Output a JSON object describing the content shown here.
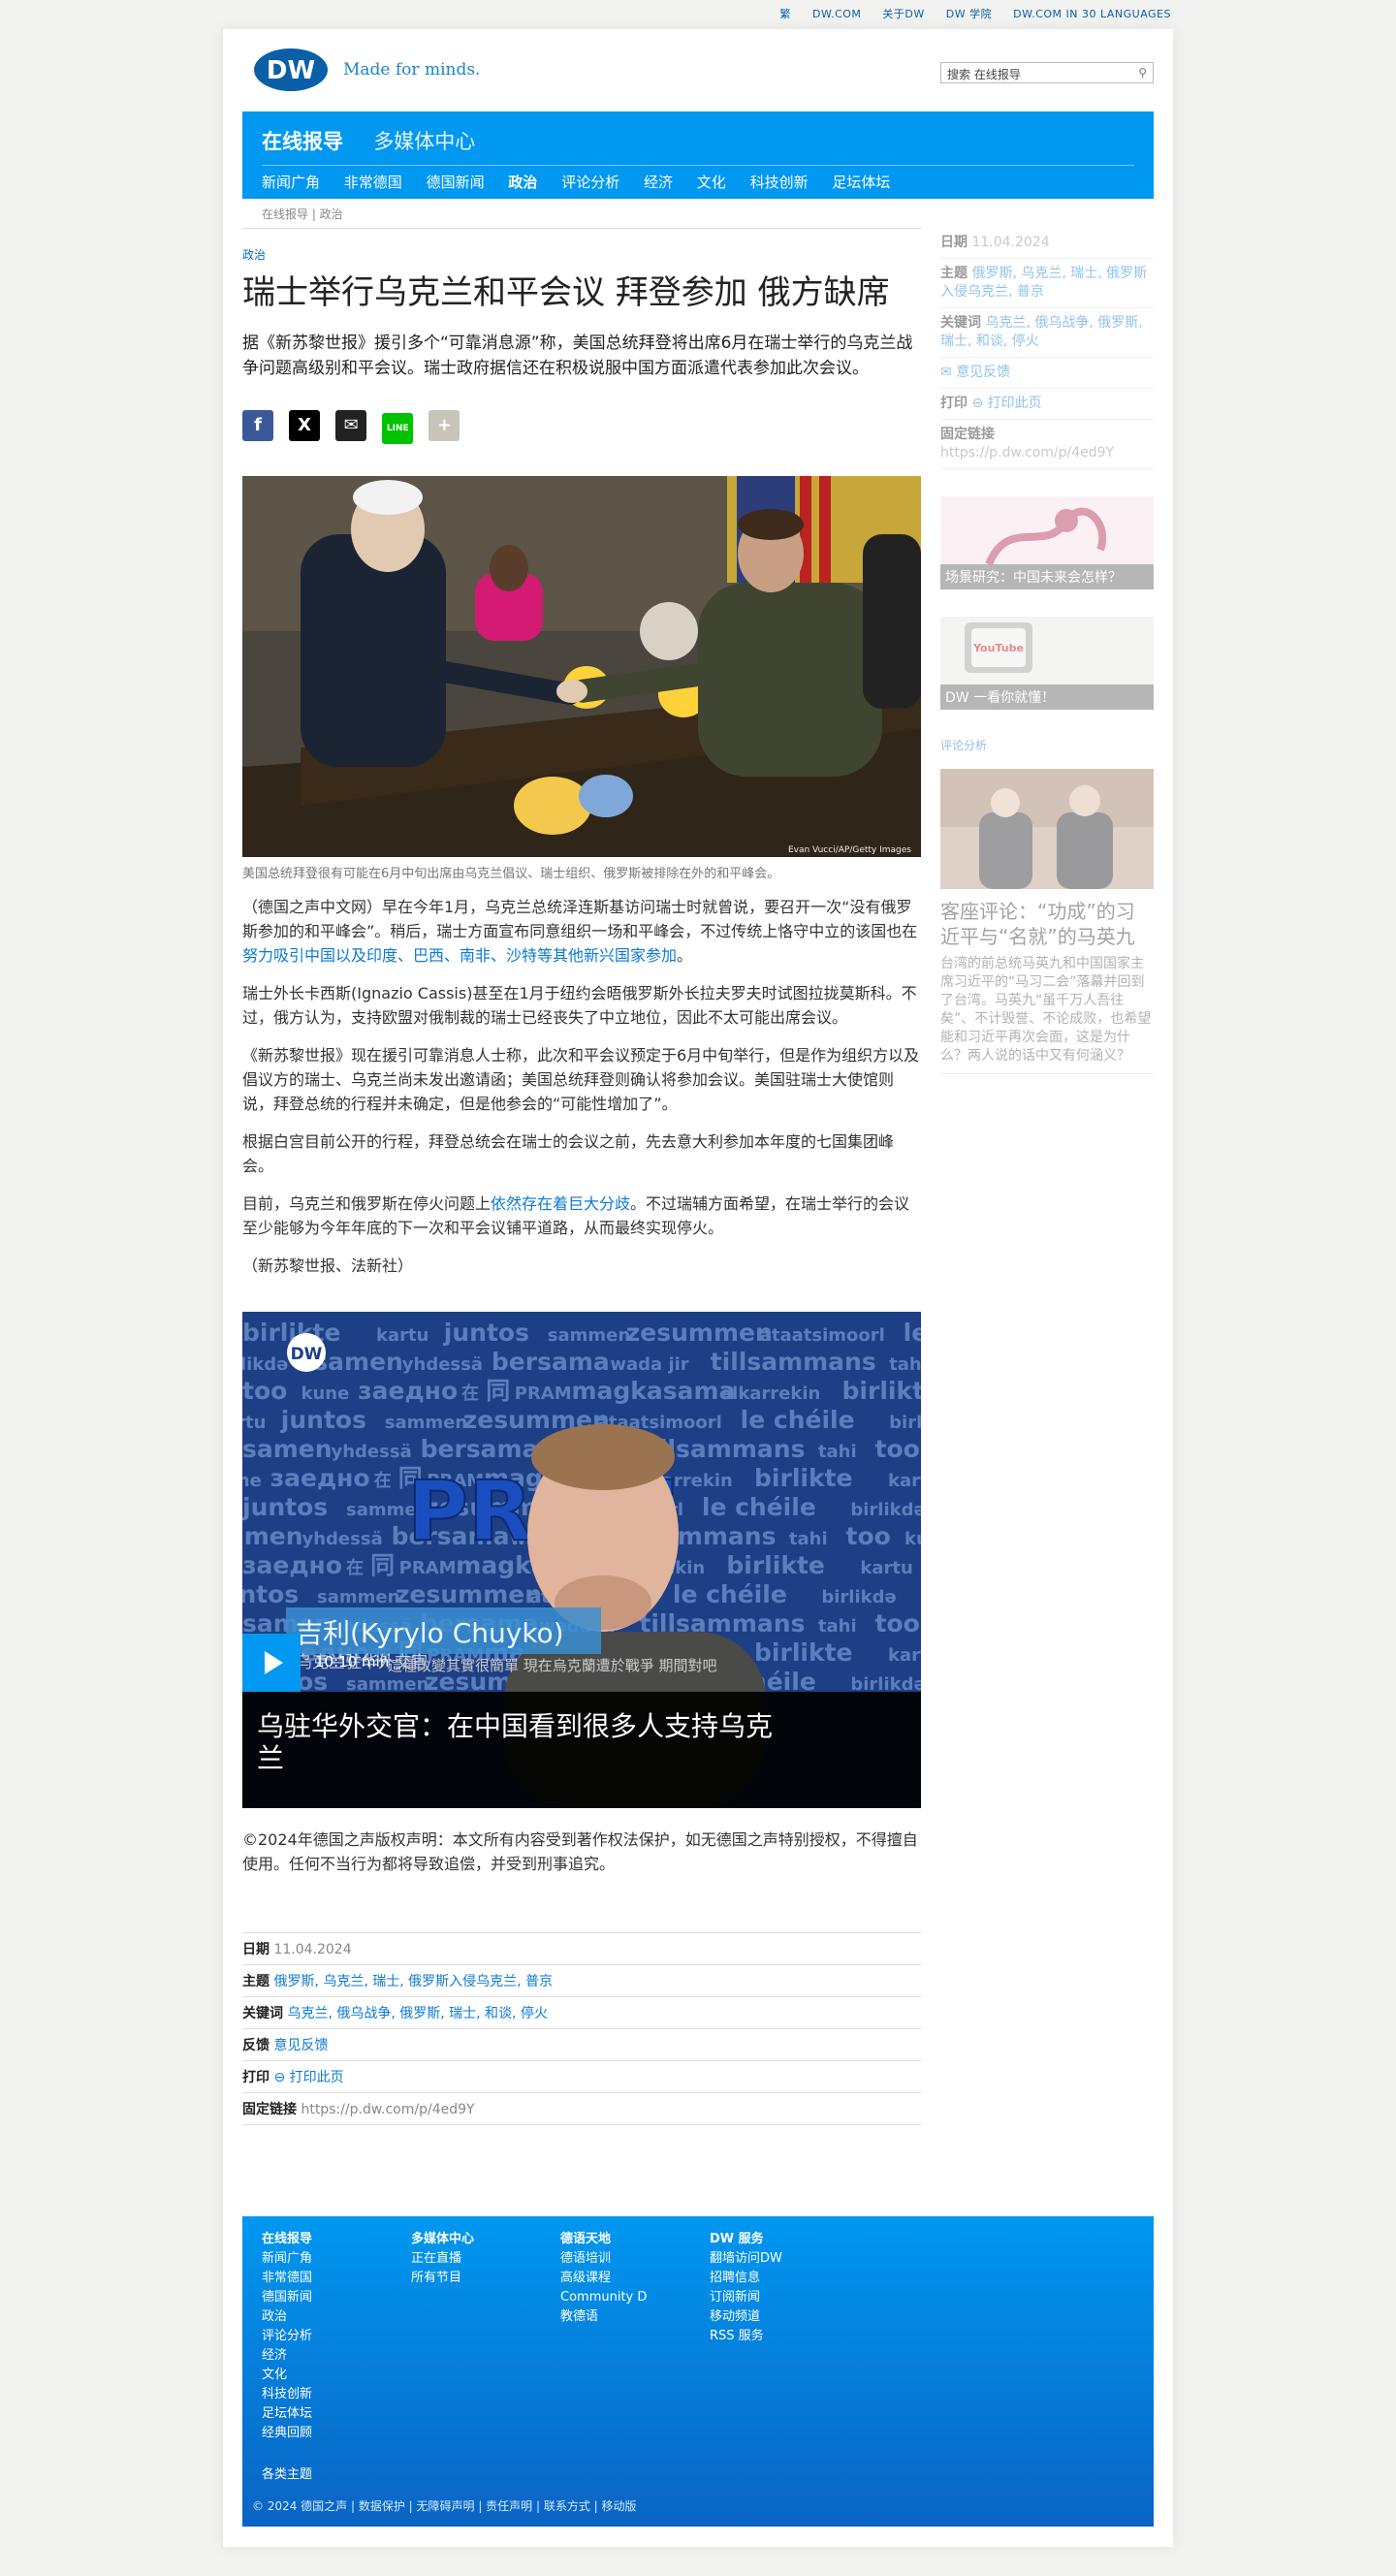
{
  "topbar": {
    "items": [
      "繁",
      "DW.COM",
      "关于DW",
      "DW 学院",
      "DW.COM IN 30 LANGUAGES"
    ]
  },
  "header": {
    "logo_text": "DW",
    "tagline": "Made for minds.",
    "search_placeholder": "搜索 在线报导"
  },
  "nav": {
    "main": [
      "在线报导",
      "多媒体中心"
    ],
    "sub": [
      "新闻广角",
      "非常德国",
      "德国新闻",
      "政治",
      "评论分析",
      "经济",
      "文化",
      "科技创新",
      "足坛体坛"
    ],
    "active": "政治"
  },
  "breadcrumb": "在线报导 | 政治",
  "article": {
    "kicker": "政治",
    "title": "瑞士举行乌克兰和平会议 拜登参加 俄方缺席",
    "lead": "据《新苏黎世报》援引多个“可靠消息源”称，美国总统拜登将出席6月在瑞士举行的乌克兰战争问题高级别和平会议。瑞士政府据信还在积极说服中国方面派遣代表参加此次会议。",
    "share": {
      "facebook": "f",
      "x": "X",
      "mail": "✉",
      "line": "LINE",
      "more": "+"
    },
    "photo_credit": "Evan Vucci/AP/Getty Images",
    "caption": "美国总统拜登很有可能在6月中旬出席由乌克兰倡议、瑞士组织、俄罗斯被排除在外的和平峰会。",
    "paragraphs": [
      {
        "before": "（德国之声中文网）早在今年1月，乌克兰总统泽连斯基访问瑞士时就曾说，要召开一次“没有俄罗斯参加的和平峰会”。稍后，瑞士方面宣布同意组织一场和平峰会，不过传统上恪守中立的该国也在",
        "link": "努力吸引中国以及印度、巴西、南非、沙特等其他新兴国家参加",
        "after": "。"
      },
      {
        "before": "瑞士外长卡西斯(Ignazio Cassis)甚至在1月于纽约会晤俄罗斯外长拉夫罗夫时试图拉拢莫斯科。不过，俄方认为，支持欧盟对俄制裁的瑞士已经丧失了中立地位，因此不太可能出席会议。",
        "link": "",
        "after": ""
      },
      {
        "before": "《新苏黎世报》现在援引可靠消息人士称，此次和平会议预定于6月中旬举行，但是作为组织方以及倡议方的瑞士、乌克兰尚未发出邀请函；美国总统拜登则确认将参加会议。美国驻瑞士大使馆则说，拜登总统的行程并未确定，但是他参会的“可能性增加了”。",
        "link": "",
        "after": ""
      },
      {
        "before": "根据白宫目前公开的行程，拜登总统会在瑞士的会议之前，先去意大利参加本年度的七国集团峰会。",
        "link": "",
        "after": ""
      },
      {
        "before": "目前，乌克兰和俄罗斯在停火问题上",
        "link": "依然存在着巨大分歧",
        "after": "。不过瑞辅方面希望，在瑞士举行的会议至少能够为今年年底的下一次和平会议铺平道路，从而最终实现停火。"
      },
      {
        "before": "（新苏黎世报、法新社）",
        "link": "",
        "after": ""
      }
    ],
    "video": {
      "logo": "DW",
      "big_word": "PRAM",
      "cloud": [
        "birlikte",
        "kartu",
        "juntos",
        "sammen",
        "zesummen",
        "ataatsimoorl",
        "le chéile",
        "birlikdə",
        "samen",
        "yhdessä",
        "bersama",
        "wada jir",
        "tillsammans",
        "tahi",
        "too",
        "kune",
        "заедно",
        "在",
        "同",
        "PRAM",
        "magkasama",
        "elkarrekin"
      ],
      "name_caption": "吉利(Kyrylo Chuyko)",
      "name_sub": "乌克兰驻华外交官",
      "subtitle": "這種改變其實很簡單 現在烏克蘭遭於戰爭 期間對吧",
      "duration": "10:10 min",
      "title": "乌驻华外交官：在中国看到很多人支持乌克兰"
    },
    "copyright": "©2024年德国之声版权声明：本文所有内容受到著作权法保护，如无德国之声特别授权，不得擅自使用。任何不当行为都将导致追偿，并受到刑事追究。",
    "meta": {
      "date_label": "日期",
      "date": "11.04.2024",
      "topics_label": "主题",
      "topics": "俄罗斯, 乌克兰, 瑞士, 俄罗斯入侵乌克兰, 普京",
      "keywords_label": "关键词",
      "keywords": "乌克兰, 俄乌战争, 俄罗斯, 瑞士, 和谈, 停火",
      "feedback_label": "反馈",
      "feedback": "意见反馈",
      "print_label": "打印",
      "print": "打印此页",
      "permalink_label": "固定链接",
      "permalink": "https://p.dw.com/p/4ed9Y"
    }
  },
  "sidebar": {
    "date_label": "日期",
    "date": "11.04.2024",
    "topics_label": "主题",
    "topics": "俄罗斯, 乌克兰, 瑞士, 俄罗斯入侵乌克兰, 普京",
    "keywords_label": "关键词",
    "keywords": "乌克兰, 俄乌战争, 俄罗斯, 瑞士, 和谈, 停火",
    "feedback": "意见反馈",
    "print_label": "打印",
    "print": "打印此页",
    "permalink_label": "固定链接",
    "permalink": "https://p.dw.com/p/4ed9Y",
    "promo1": "场景研究：中国未来会怎样？",
    "promo2": "DW 一看你就懂！",
    "promo2_logo": "YouTube",
    "section_label": "评论分析",
    "comment_title": "客座评论：“功成”的习近平与“名就”的马英九",
    "comment_text": "台湾的前总统马英九和中国国家主席习近平的“马习二会”落幕并回到了台湾。马英九“虽千万人吾往矣”、不计毁誉、不论成败，也希望能和习近平再次会面，这是为什么？两人说的话中又有何涵义？"
  },
  "footer": {
    "columns": [
      {
        "title": "在线报导",
        "items": [
          "新闻广角",
          "非常德国",
          "德国新闻",
          "政治",
          "评论分析",
          "经济",
          "文化",
          "科技创新",
          "足坛体坛",
          "经典回顾"
        ]
      },
      {
        "title": "多媒体中心",
        "items": [
          "正在直播",
          "所有节目"
        ]
      },
      {
        "title": "德语天地",
        "items": [
          "德语培训",
          "高级课程",
          "Community D",
          "教德语"
        ]
      },
      {
        "title": "DW 服务",
        "items": [
          "翻墙访问DW",
          "招聘信息",
          "订阅新闻",
          "移动频道",
          "RSS 服务"
        ]
      }
    ],
    "extra": "各类主题",
    "legal": "© 2024 德国之声 | 数据保护 | 无障碍声明 | 责任声明 | 联系方式 | 移动版"
  }
}
